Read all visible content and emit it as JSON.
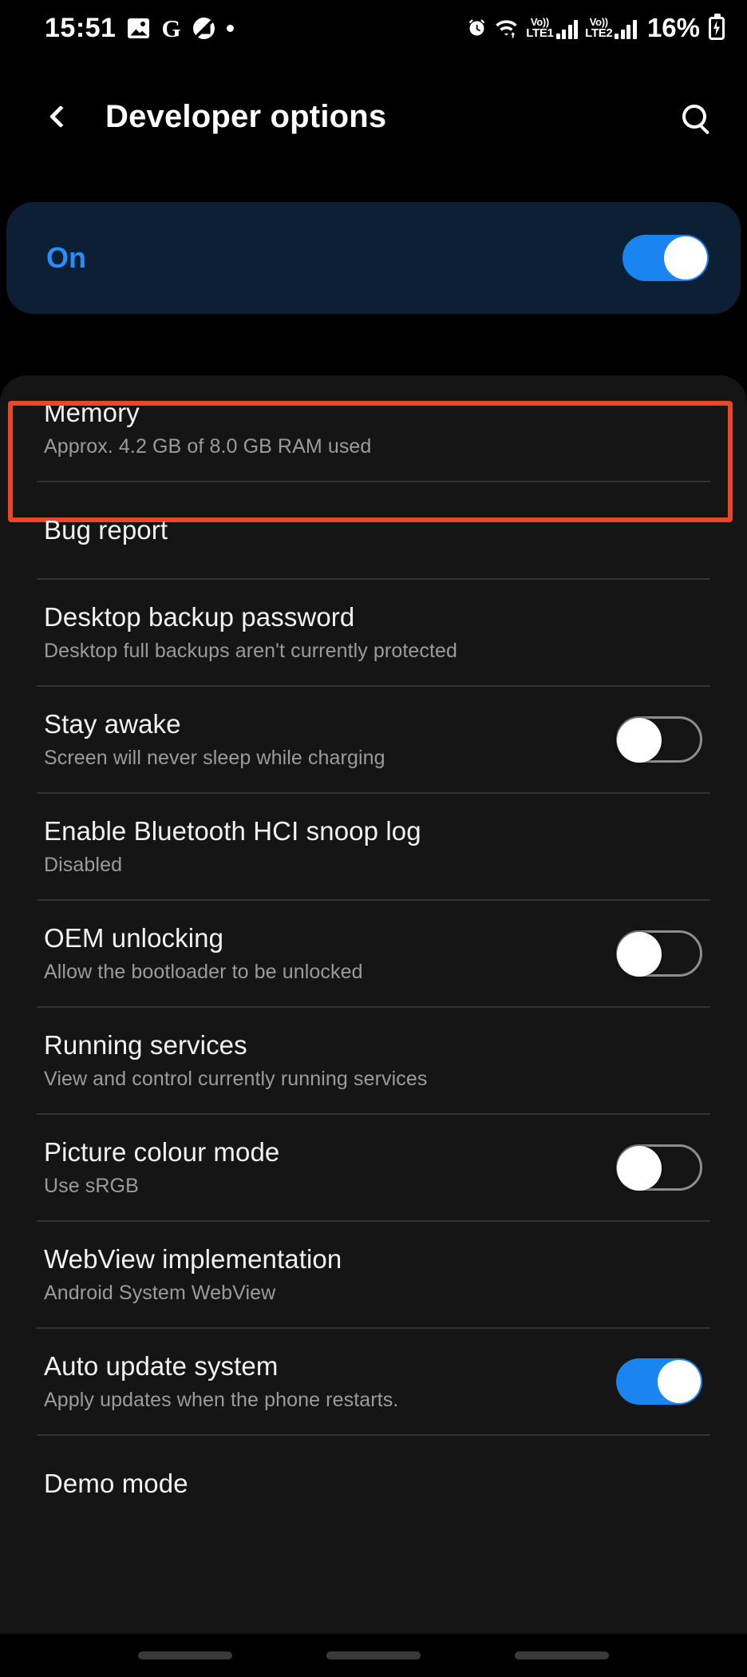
{
  "status_bar": {
    "time": "15:51",
    "left_icons": [
      "gallery-icon",
      "google-icon",
      "mute-icon",
      "dot-icon"
    ],
    "right_icons": [
      "alarm-icon",
      "wifi-icon"
    ],
    "sim1": {
      "network_label_top": "Vo))",
      "network_label_bottom": "LTE1"
    },
    "sim2": {
      "network_label_top": "Vo))",
      "network_label_bottom": "LTE2"
    },
    "battery_percent": "16%",
    "battery_state": "charging"
  },
  "app_bar": {
    "back_icon": "back-chevron-icon",
    "title": "Developer options",
    "search_icon": "search-icon"
  },
  "master_toggle": {
    "label": "On",
    "state": "on",
    "accent_color": "#1a84f0",
    "card_color": "#0c1f35",
    "label_color": "#2a8cf5"
  },
  "highlight": {
    "color": "#e8472a",
    "target": "Memory"
  },
  "settings": [
    {
      "title": "Memory",
      "subtitle": "Approx. 4.2 GB of 8.0 GB RAM used",
      "control": "none",
      "highlighted": true,
      "divider": true
    },
    {
      "title": "Bug report",
      "subtitle": "",
      "control": "none",
      "highlighted": false,
      "divider": true
    },
    {
      "title": "Desktop backup password",
      "subtitle": "Desktop full backups aren't currently protected",
      "control": "none",
      "highlighted": false,
      "divider": true
    },
    {
      "title": "Stay awake",
      "subtitle": "Screen will never sleep while charging",
      "control": "toggle",
      "toggle_state": "off",
      "highlighted": false,
      "divider": true
    },
    {
      "title": "Enable Bluetooth HCI snoop log",
      "subtitle": "Disabled",
      "control": "none",
      "highlighted": false,
      "divider": true
    },
    {
      "title": "OEM unlocking",
      "subtitle": "Allow the bootloader to be unlocked",
      "control": "toggle",
      "toggle_state": "off",
      "highlighted": false,
      "divider": true
    },
    {
      "title": "Running services",
      "subtitle": "View and control currently running services",
      "control": "none",
      "highlighted": false,
      "divider": true
    },
    {
      "title": "Picture colour mode",
      "subtitle": "Use sRGB",
      "control": "toggle",
      "toggle_state": "off",
      "highlighted": false,
      "divider": true
    },
    {
      "title": "WebView implementation",
      "subtitle": "Android System WebView",
      "control": "none",
      "highlighted": false,
      "divider": true
    },
    {
      "title": "Auto update system",
      "subtitle": "Apply updates when the phone restarts.",
      "control": "toggle",
      "toggle_state": "on",
      "highlighted": false,
      "divider": true
    },
    {
      "title": "Demo mode",
      "subtitle": "",
      "control": "none",
      "highlighted": false,
      "divider": false
    }
  ],
  "nav_bar": {
    "pills": 3
  }
}
